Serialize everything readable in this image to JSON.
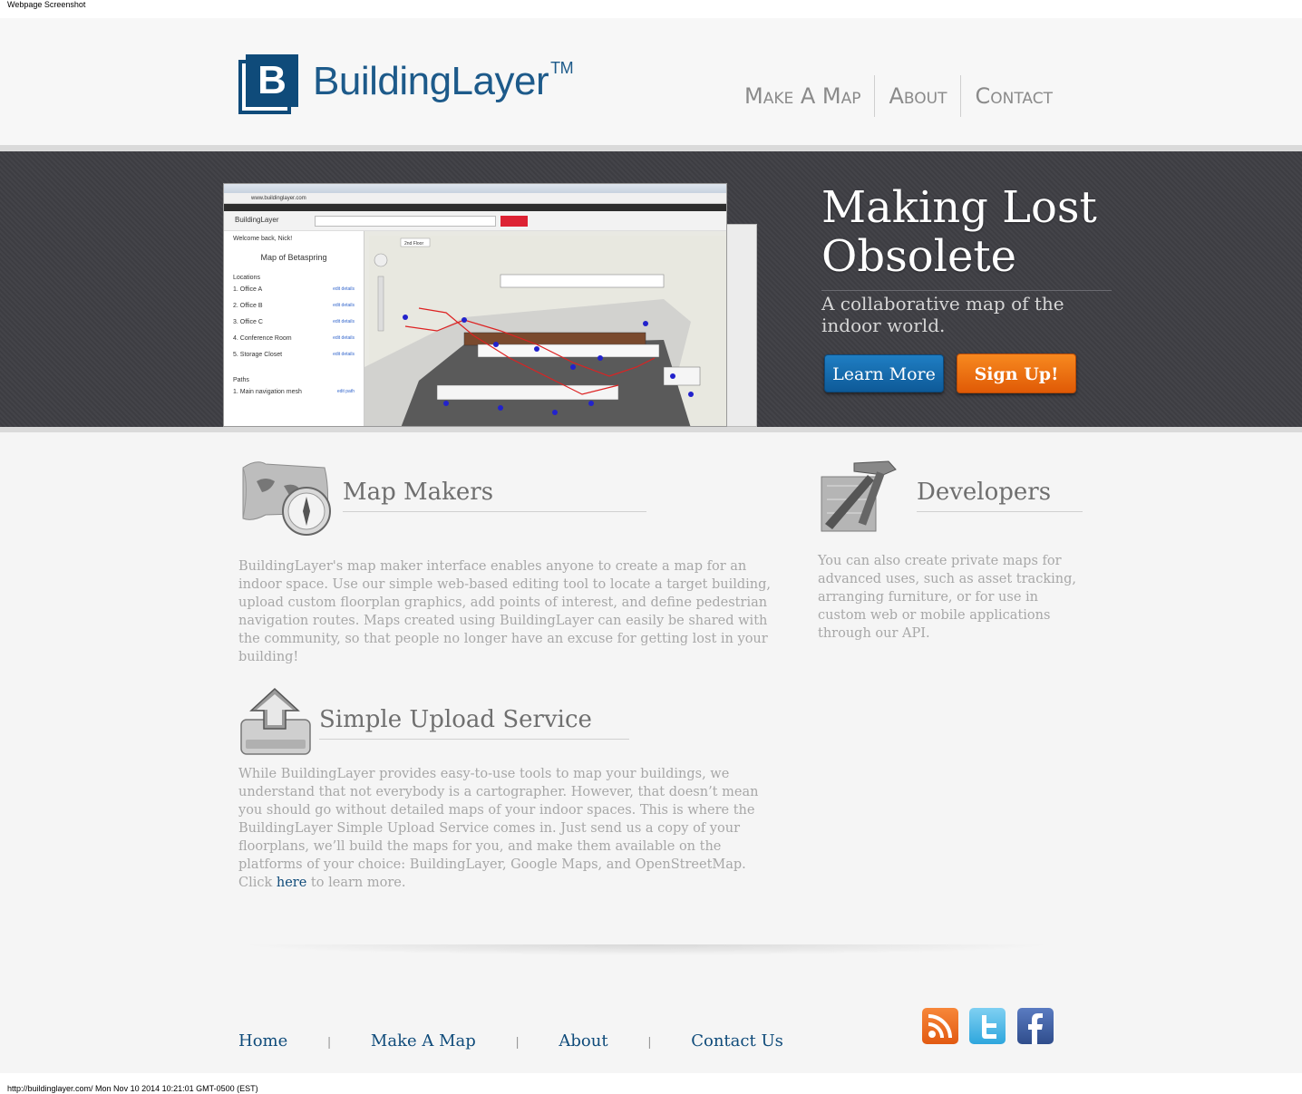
{
  "print": {
    "header": "Webpage Screenshot",
    "footer": "http://buildinglayer.com/ Mon Nov 10 2014 10:21:01 GMT-0500 (EST)"
  },
  "header": {
    "logo_letter": "B",
    "logo_text": "BuildingLayer",
    "logo_tm": "TM",
    "nav": [
      {
        "label": "Make A Map"
      },
      {
        "label": "About"
      },
      {
        "label": "Contact"
      }
    ]
  },
  "hero": {
    "title_line1": "Making Lost",
    "title_line2": "Obsolete",
    "subtitle": "A collaborative map of the indoor world.",
    "learn_more": "Learn More",
    "sign_up": "Sign Up!",
    "screenshot": {
      "address": "www.buildinglayer.com",
      "brand": "BuildingLayer",
      "welcome": "Welcome back, Nick!",
      "map_title": "Map of Betaspring",
      "locations_heading": "Locations",
      "locations": [
        "1. Office A",
        "2. Office B",
        "3. Office C",
        "4. Conference Room",
        "5. Storage Closet"
      ],
      "edit_label": "edit details",
      "paths_heading": "Paths",
      "paths": [
        "1. Main navigation mesh"
      ],
      "edit_path": "edit path",
      "floor": "2nd Floor"
    }
  },
  "sections": {
    "map_makers": {
      "title": "Map Makers",
      "text": "BuildingLayer's map maker interface enables anyone to create a map for an indoor space. Use our simple web-based editing tool to locate a target building, upload custom floorplan graphics, add points of interest, and define pedestrian navigation routes. Maps created using BuildingLayer can easily be shared with the community, so that people no longer have an excuse for getting lost in your building!"
    },
    "developers": {
      "title": "Developers",
      "text": "You can also create private maps for advanced uses, such as asset tracking, arranging furniture, or for use in custom web or mobile applications through our API."
    },
    "upload": {
      "title": "Simple Upload Service",
      "text_before": "While BuildingLayer provides easy-to-use tools to map your buildings, we understand that not everybody is a cartographer. However, that doesn’t mean you should go without detailed maps of your indoor spaces. This is where the BuildingLayer Simple Upload Service comes in. Just send us a copy of your floorplans, we’ll build the maps for you, and make them available on the platforms of your choice: BuildingLayer, Google Maps, and OpenStreetMap. Click ",
      "link": "here",
      "text_after": " to learn more."
    }
  },
  "footer": {
    "links": [
      {
        "label": "Home"
      },
      {
        "label": "Make A Map"
      },
      {
        "label": "About"
      },
      {
        "label": "Contact Us"
      }
    ],
    "separator": "|",
    "social": [
      {
        "icon": "rss-icon",
        "color": "#f26522"
      },
      {
        "icon": "twitter-icon",
        "color": "#3cb3e6"
      },
      {
        "icon": "facebook-icon",
        "color": "#3b5998"
      }
    ]
  },
  "colors": {
    "brand_blue": "#0f4b7a",
    "hero_bg": "#3f3f45",
    "learn_more": "#1a6fb0",
    "sign_up": "#ef7010"
  }
}
